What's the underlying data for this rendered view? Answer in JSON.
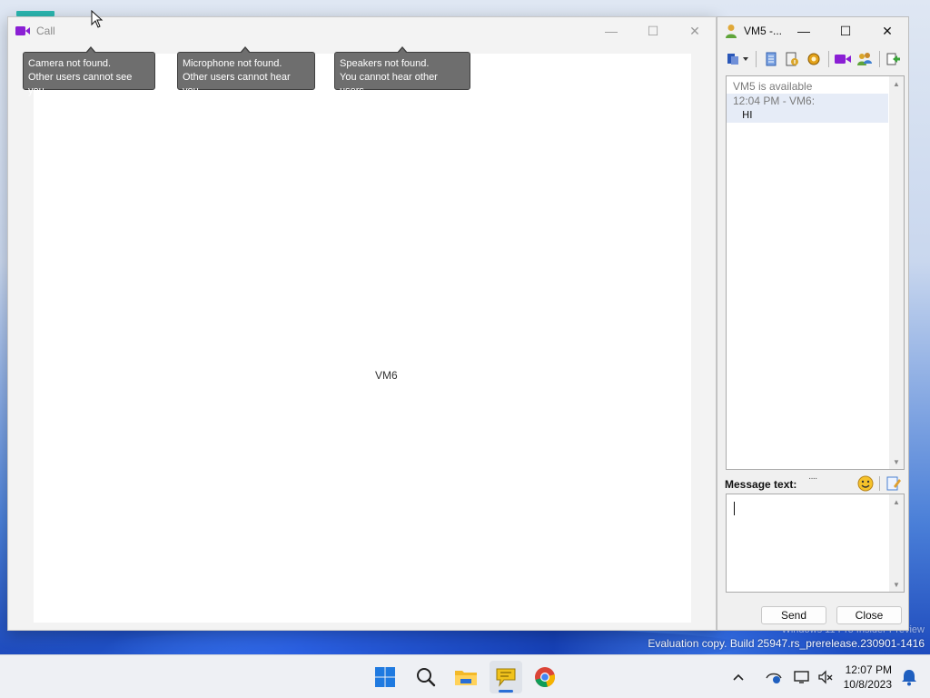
{
  "call_window": {
    "title": "Call",
    "participant_name": "VM6",
    "notifications": [
      {
        "line1": "Camera not found.",
        "line2": "Other users cannot see you."
      },
      {
        "line1": "Microphone not found.",
        "line2": "Other users cannot hear you."
      },
      {
        "line1": "Speakers not found.",
        "line2": "You cannot hear other users."
      }
    ],
    "controls": {
      "minimize": "—",
      "maximize": "☐",
      "close": "✕"
    }
  },
  "chat_window": {
    "title": "VM5 -...",
    "controls": {
      "minimize": "—",
      "maximize": "☐",
      "close": "✕"
    },
    "toolbar_icons": [
      "send-file-menu-icon",
      "history-icon",
      "user-info-icon",
      "plugins-icon",
      "video-call-icon",
      "add-users-icon",
      "exit-icon"
    ],
    "log": {
      "status": "VM5 is available",
      "messages": [
        {
          "meta": "12:04 PM - VM6:",
          "text": "HI"
        }
      ]
    },
    "message_label": "Message text:",
    "grip": "····",
    "input_value": "",
    "send_label": "Send",
    "close_label": "Close"
  },
  "taskbar": {
    "apps": [
      "start-icon",
      "search-icon",
      "file-explorer-icon",
      "messenger-app-icon",
      "chrome-icon"
    ],
    "active_app": "messenger-app-icon",
    "tray_icons": [
      "show-hidden-icons-chevron",
      "network-info-icon",
      "display-icon",
      "volume-muted-icon"
    ],
    "time": "12:07 PM",
    "date": "10/8/2023"
  },
  "desktop": {
    "watermark_line1": "Windows 11 Pro Insider Preview",
    "watermark_line2": "Evaluation copy. Build 25947.rs_prerelease.230901-1416"
  },
  "colors": {
    "tooltip_bg": "#6e6e6e",
    "accent": "#2a6fd6",
    "video_icon": "#8a1fd4"
  }
}
